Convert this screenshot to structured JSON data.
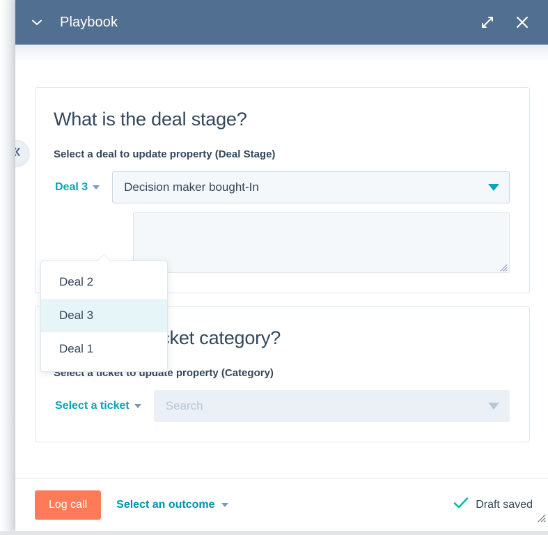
{
  "header": {
    "title": "Playbook",
    "collapse_icon": "chevron-down-icon",
    "expand_icon": "expand-diagonal-icon",
    "close_icon": "close-icon"
  },
  "side": {
    "collapse_icon": "chevrons-left-icon"
  },
  "cards": [
    {
      "title": "What is the deal stage?",
      "prompt": "Select a deal to update property (Deal Stage)",
      "record_select_label": "Deal 3",
      "property_value": "Decision maker bought-In",
      "note_value": "",
      "has_note": true,
      "disabled": false
    },
    {
      "title": "What is the ticket category?",
      "prompt": "Select a ticket to update property (Category)",
      "record_select_label": "Select a ticket",
      "property_value": "Search",
      "note_value": "",
      "has_note": false,
      "disabled": true
    }
  ],
  "popover": {
    "options": [
      {
        "label": "Deal 2",
        "selected": false
      },
      {
        "label": "Deal 3",
        "selected": true
      },
      {
        "label": "Deal 1",
        "selected": false
      }
    ]
  },
  "footer": {
    "primary_label": "Log call",
    "outcome_label": "Select an outcome",
    "status_label": "Draft saved",
    "status_icon": "check-icon"
  },
  "colors": {
    "header_blue": "#516F90",
    "brand_orange": "#FF7A59",
    "teal": "#00A4BD",
    "text_dark": "#33475b",
    "highlight": "#E5F5F8",
    "field_fill": "#F5F8FA",
    "disabled_fill": "#EAF0F6",
    "check_green": "#00BDA5"
  }
}
